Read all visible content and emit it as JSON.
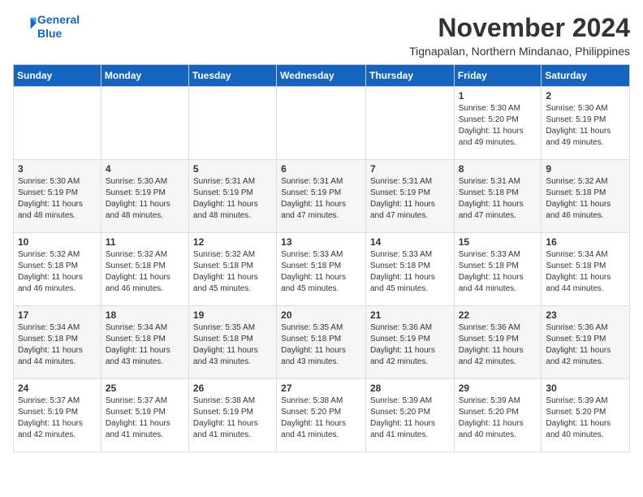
{
  "header": {
    "logo_line1": "General",
    "logo_line2": "Blue",
    "month": "November 2024",
    "location": "Tignapalan, Northern Mindanao, Philippines"
  },
  "days_of_week": [
    "Sunday",
    "Monday",
    "Tuesday",
    "Wednesday",
    "Thursday",
    "Friday",
    "Saturday"
  ],
  "weeks": [
    [
      {
        "day": "",
        "info": ""
      },
      {
        "day": "",
        "info": ""
      },
      {
        "day": "",
        "info": ""
      },
      {
        "day": "",
        "info": ""
      },
      {
        "day": "",
        "info": ""
      },
      {
        "day": "1",
        "info": "Sunrise: 5:30 AM\nSunset: 5:20 PM\nDaylight: 11 hours\nand 49 minutes."
      },
      {
        "day": "2",
        "info": "Sunrise: 5:30 AM\nSunset: 5:19 PM\nDaylight: 11 hours\nand 49 minutes."
      }
    ],
    [
      {
        "day": "3",
        "info": "Sunrise: 5:30 AM\nSunset: 5:19 PM\nDaylight: 11 hours\nand 48 minutes."
      },
      {
        "day": "4",
        "info": "Sunrise: 5:30 AM\nSunset: 5:19 PM\nDaylight: 11 hours\nand 48 minutes."
      },
      {
        "day": "5",
        "info": "Sunrise: 5:31 AM\nSunset: 5:19 PM\nDaylight: 11 hours\nand 48 minutes."
      },
      {
        "day": "6",
        "info": "Sunrise: 5:31 AM\nSunset: 5:19 PM\nDaylight: 11 hours\nand 47 minutes."
      },
      {
        "day": "7",
        "info": "Sunrise: 5:31 AM\nSunset: 5:19 PM\nDaylight: 11 hours\nand 47 minutes."
      },
      {
        "day": "8",
        "info": "Sunrise: 5:31 AM\nSunset: 5:18 PM\nDaylight: 11 hours\nand 47 minutes."
      },
      {
        "day": "9",
        "info": "Sunrise: 5:32 AM\nSunset: 5:18 PM\nDaylight: 11 hours\nand 46 minutes."
      }
    ],
    [
      {
        "day": "10",
        "info": "Sunrise: 5:32 AM\nSunset: 5:18 PM\nDaylight: 11 hours\nand 46 minutes."
      },
      {
        "day": "11",
        "info": "Sunrise: 5:32 AM\nSunset: 5:18 PM\nDaylight: 11 hours\nand 46 minutes."
      },
      {
        "day": "12",
        "info": "Sunrise: 5:32 AM\nSunset: 5:18 PM\nDaylight: 11 hours\nand 45 minutes."
      },
      {
        "day": "13",
        "info": "Sunrise: 5:33 AM\nSunset: 5:18 PM\nDaylight: 11 hours\nand 45 minutes."
      },
      {
        "day": "14",
        "info": "Sunrise: 5:33 AM\nSunset: 5:18 PM\nDaylight: 11 hours\nand 45 minutes."
      },
      {
        "day": "15",
        "info": "Sunrise: 5:33 AM\nSunset: 5:18 PM\nDaylight: 11 hours\nand 44 minutes."
      },
      {
        "day": "16",
        "info": "Sunrise: 5:34 AM\nSunset: 5:18 PM\nDaylight: 11 hours\nand 44 minutes."
      }
    ],
    [
      {
        "day": "17",
        "info": "Sunrise: 5:34 AM\nSunset: 5:18 PM\nDaylight: 11 hours\nand 44 minutes."
      },
      {
        "day": "18",
        "info": "Sunrise: 5:34 AM\nSunset: 5:18 PM\nDaylight: 11 hours\nand 43 minutes."
      },
      {
        "day": "19",
        "info": "Sunrise: 5:35 AM\nSunset: 5:18 PM\nDaylight: 11 hours\nand 43 minutes."
      },
      {
        "day": "20",
        "info": "Sunrise: 5:35 AM\nSunset: 5:18 PM\nDaylight: 11 hours\nand 43 minutes."
      },
      {
        "day": "21",
        "info": "Sunrise: 5:36 AM\nSunset: 5:19 PM\nDaylight: 11 hours\nand 42 minutes."
      },
      {
        "day": "22",
        "info": "Sunrise: 5:36 AM\nSunset: 5:19 PM\nDaylight: 11 hours\nand 42 minutes."
      },
      {
        "day": "23",
        "info": "Sunrise: 5:36 AM\nSunset: 5:19 PM\nDaylight: 11 hours\nand 42 minutes."
      }
    ],
    [
      {
        "day": "24",
        "info": "Sunrise: 5:37 AM\nSunset: 5:19 PM\nDaylight: 11 hours\nand 42 minutes."
      },
      {
        "day": "25",
        "info": "Sunrise: 5:37 AM\nSunset: 5:19 PM\nDaylight: 11 hours\nand 41 minutes."
      },
      {
        "day": "26",
        "info": "Sunrise: 5:38 AM\nSunset: 5:19 PM\nDaylight: 11 hours\nand 41 minutes."
      },
      {
        "day": "27",
        "info": "Sunrise: 5:38 AM\nSunset: 5:20 PM\nDaylight: 11 hours\nand 41 minutes."
      },
      {
        "day": "28",
        "info": "Sunrise: 5:39 AM\nSunset: 5:20 PM\nDaylight: 11 hours\nand 41 minutes."
      },
      {
        "day": "29",
        "info": "Sunrise: 5:39 AM\nSunset: 5:20 PM\nDaylight: 11 hours\nand 40 minutes."
      },
      {
        "day": "30",
        "info": "Sunrise: 5:39 AM\nSunset: 5:20 PM\nDaylight: 11 hours\nand 40 minutes."
      }
    ]
  ]
}
